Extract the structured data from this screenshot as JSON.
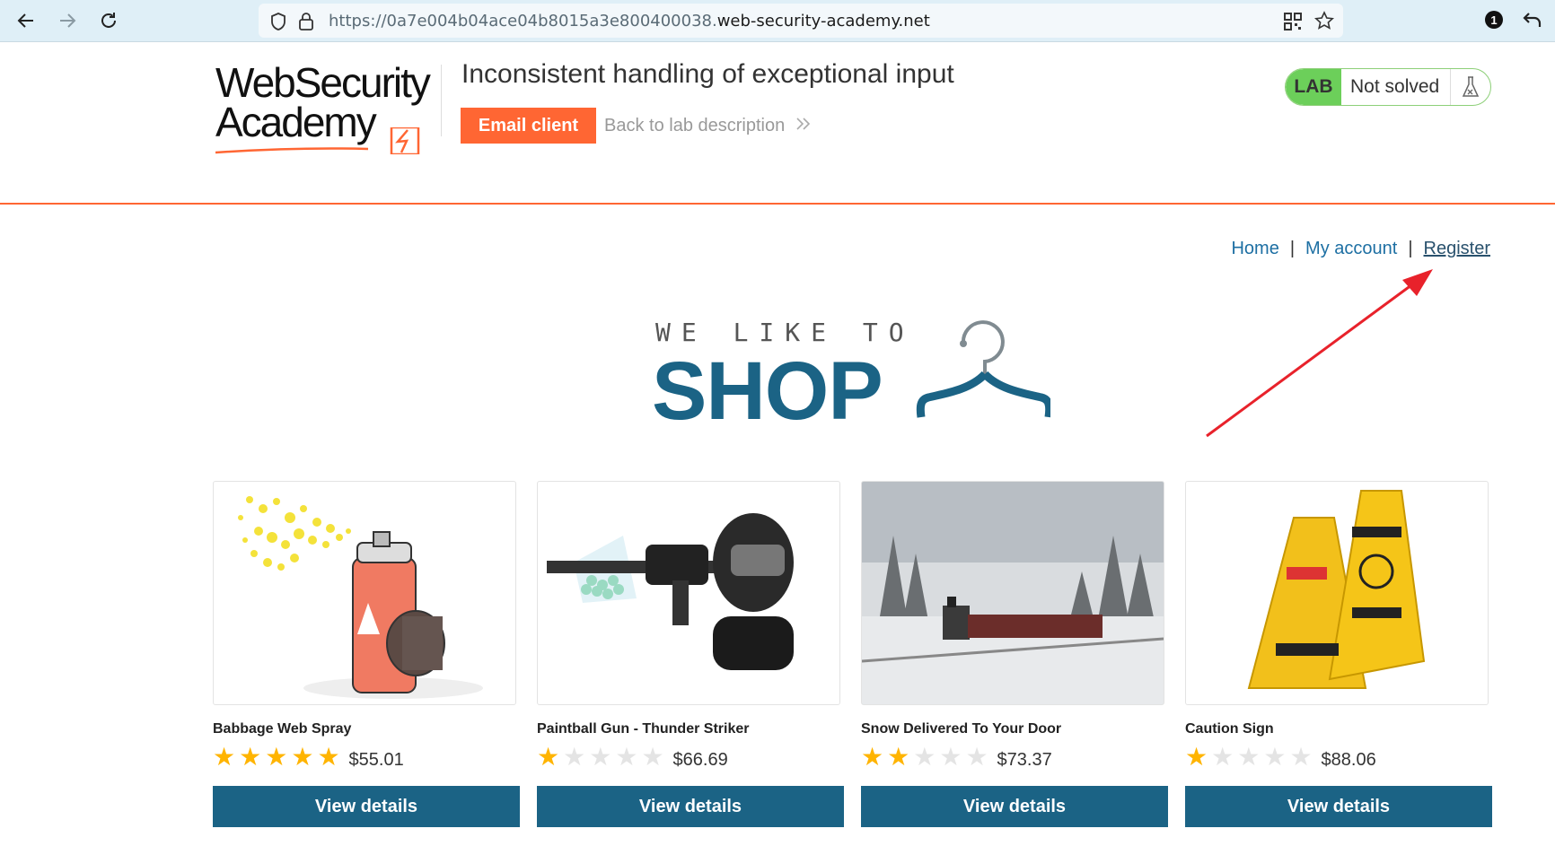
{
  "browser": {
    "url_prefix": "https://0a7e004b04ace04b8015a3e800400038.",
    "url_host": "web-security-academy.net",
    "notification_count": "1"
  },
  "header": {
    "logo_line1": "WebSecurity",
    "logo_line2": "Academy",
    "lab_title": "Inconsistent handling of exceptional input",
    "email_client_label": "Email client",
    "back_link_label": "Back to lab description",
    "lab_badge_label": "LAB",
    "lab_status": "Not solved"
  },
  "nav": {
    "home": "Home",
    "my_account": "My account",
    "register": "Register",
    "separator": "|"
  },
  "banner": {
    "small_text": "WE LIKE TO",
    "big_text": "SHOP"
  },
  "products": [
    {
      "name": "Babbage Web Spray",
      "price": "$55.01",
      "rating": 5,
      "button": "View details"
    },
    {
      "name": "Paintball Gun - Thunder Striker",
      "price": "$66.69",
      "rating": 1,
      "button": "View details"
    },
    {
      "name": "Snow Delivered To Your Door",
      "price": "$73.37",
      "rating": 2,
      "button": "View details"
    },
    {
      "name": "Caution Sign",
      "price": "$88.06",
      "rating": 1,
      "button": "View details"
    }
  ],
  "colors": {
    "accent_orange": "#ff6633",
    "primary_blue": "#1b6385",
    "lab_green": "#6ccf5a",
    "annotation_red": "#e8222b"
  }
}
